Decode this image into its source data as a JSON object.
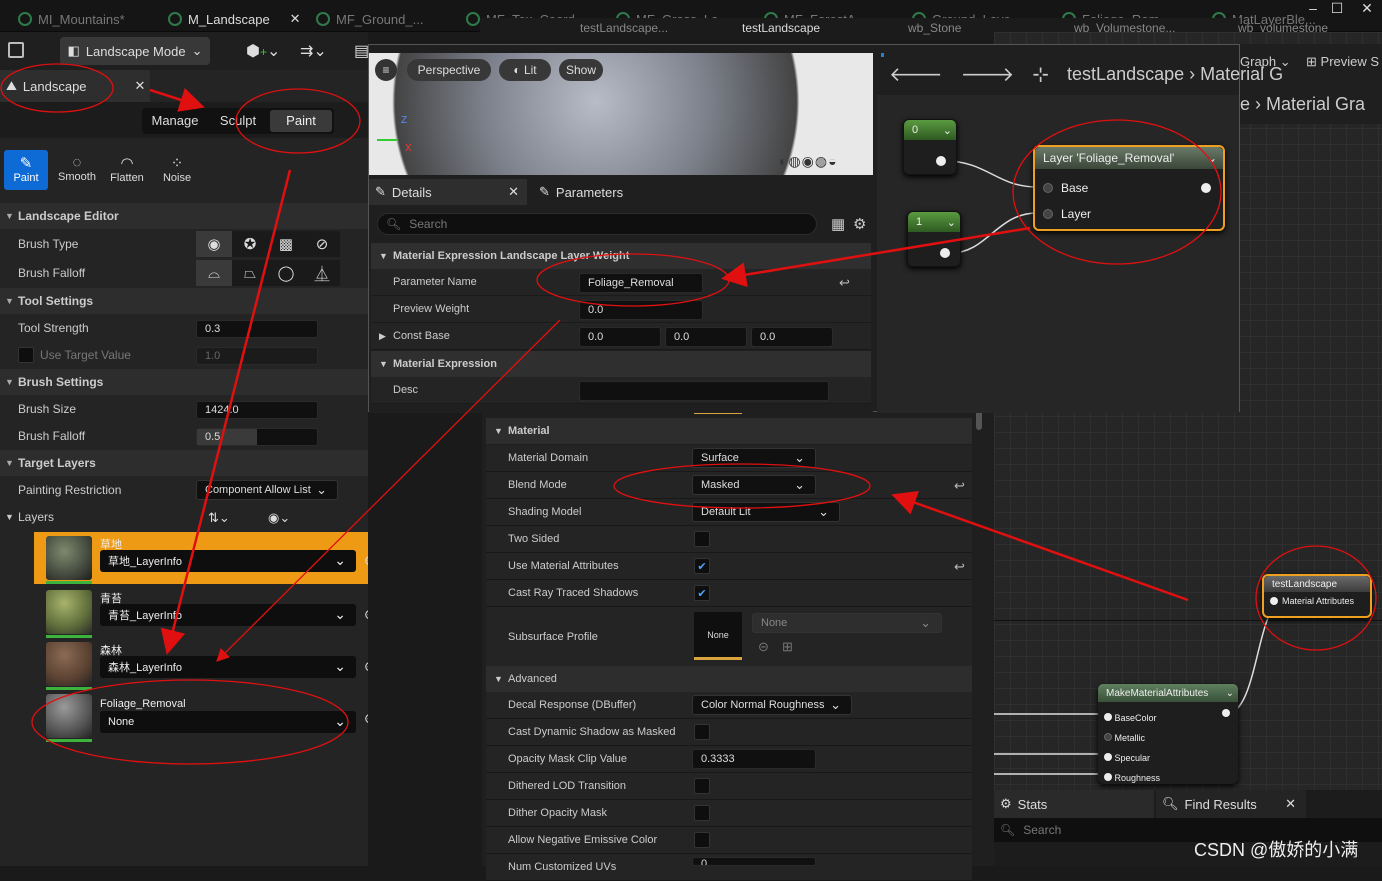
{
  "tabs": [
    "MI_Mountains*",
    "M_Landscape",
    "MF_Ground_...",
    "MF_Tex_Coord",
    "MF_Grass_La...",
    "MF_ForestA...",
    "Ground_Laye...",
    "Foliage_Rem...",
    "MatLayerBle..."
  ],
  "subtabs": [
    "testLandscape...",
    "testLandscape",
    "wb_Stone",
    "wb_Volumestone...",
    "wb_volumestone"
  ],
  "toolbar": {
    "mode_label": "Landscape Mode"
  },
  "landscape_panel": {
    "tab_label": "Landscape",
    "modes": [
      "Manage",
      "Sculpt",
      "Paint"
    ],
    "tools": [
      "Paint",
      "Smooth",
      "Flatten",
      "Noise"
    ],
    "sec_editor": "Landscape Editor",
    "brush_type": "Brush Type",
    "brush_falloff": "Brush Falloff",
    "sec_tool": "Tool Settings",
    "tool_strength": "Tool Strength",
    "tool_strength_val": "0.3",
    "use_target": "Use Target Value",
    "use_target_val": "1.0",
    "sec_brush": "Brush Settings",
    "brush_size": "Brush Size",
    "brush_size_val": "1424.0",
    "brush_falloff2": "Brush Falloff",
    "brush_falloff_val": "0.5",
    "sec_target": "Target Layers",
    "painting_restriction": "Painting Restriction",
    "painting_restriction_val": "Component Allow List",
    "layers_label": "Layers",
    "layers": [
      {
        "name": "草地",
        "info": "草地_LayerInfo"
      },
      {
        "name": "青苔",
        "info": "青苔_LayerInfo"
      },
      {
        "name": "森林",
        "info": "森林_LayerInfo"
      },
      {
        "name": "Foliage_Removal",
        "info": "None"
      }
    ]
  },
  "viewport": {
    "perspective": "Perspective",
    "lit": "Lit",
    "show": "Show"
  },
  "details": {
    "tab": "Details",
    "tab2": "Parameters",
    "search_placeholder": "Search",
    "sec1": "Material Expression Landscape Layer Weight",
    "param_name": "Parameter Name",
    "param_name_val": "Foliage_Removal",
    "preview_weight": "Preview Weight",
    "preview_weight_val": "0.0",
    "const_base": "Const Base",
    "const_base_vals": [
      "0.0",
      "0.0",
      "0.0"
    ],
    "sec2": "Material Expression",
    "desc": "Desc"
  },
  "graph_top": {
    "title": "testLandscape",
    "crumb": "Material G",
    "crumb2": "e",
    "crumb3": "Material Gra",
    "raph": "Graph",
    "preview": "Preview S"
  },
  "nodes": {
    "const0": "0",
    "const1": "1",
    "layer_title": "Layer 'Foliage_Removal'",
    "layer_pins": [
      "Base",
      "Layer"
    ],
    "result_title": "testLandscape",
    "result_pin": "Material Attributes",
    "mma_title": "MakeMaterialAttributes",
    "mma_pins": [
      "BaseColor",
      "Metallic",
      "Specular",
      "Roughness"
    ]
  },
  "material": {
    "sec": "Material",
    "rows": [
      {
        "label": "Material Domain",
        "value": "Surface"
      },
      {
        "label": "Blend Mode",
        "value": "Masked"
      },
      {
        "label": "Shading Model",
        "value": "Default Lit"
      },
      {
        "label": "Two Sided",
        "value": ""
      },
      {
        "label": "Use Material Attributes",
        "value": "✔"
      },
      {
        "label": "Cast Ray Traced Shadows",
        "value": "✔"
      },
      {
        "label": "Subsurface Profile",
        "value": "None"
      }
    ],
    "subsurface_dd": "None",
    "sec_adv": "Advanced",
    "adv": [
      {
        "label": "Decal Response (DBuffer)",
        "value": "Color Normal Roughness"
      },
      {
        "label": "Cast Dynamic Shadow as Masked",
        "value": ""
      },
      {
        "label": "Opacity Mask Clip Value",
        "value": "0.3333"
      },
      {
        "label": "Dithered LOD Transition",
        "value": ""
      },
      {
        "label": "Dither Opacity Mask",
        "value": ""
      },
      {
        "label": "Allow Negative Emissive Color",
        "value": ""
      },
      {
        "label": "Num Customized UVs",
        "value": "0"
      }
    ]
  },
  "bottom": {
    "stats": "Stats",
    "find": "Find Results",
    "search": "Search"
  },
  "watermark": "CSDN @傲娇的小满"
}
